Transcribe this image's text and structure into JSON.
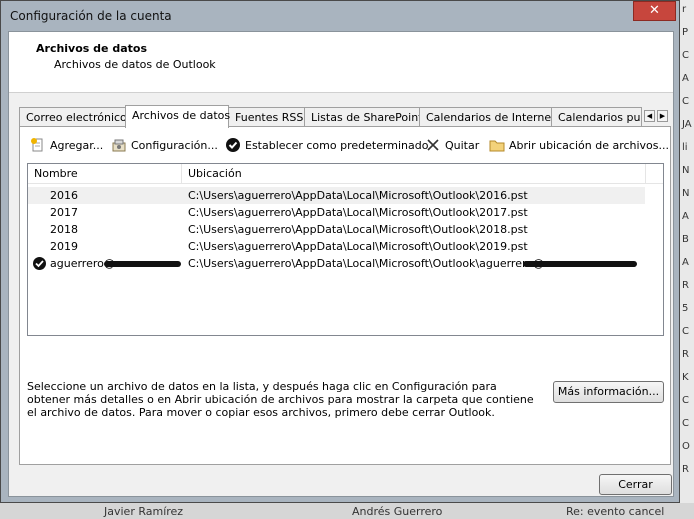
{
  "window": {
    "title": "Configuración de la cuenta",
    "close_glyph": "✕"
  },
  "header": {
    "title": "Archivos de datos",
    "subtitle": "Archivos de datos de Outlook"
  },
  "tabs": [
    {
      "label": "Correo electrónico",
      "active": false
    },
    {
      "label": "Archivos de datos",
      "active": true
    },
    {
      "label": "Fuentes RSS",
      "active": false
    },
    {
      "label": "Listas de SharePoint",
      "active": false
    },
    {
      "label": "Calendarios de Internet",
      "active": false
    },
    {
      "label": "Calendarios pul",
      "active": false
    }
  ],
  "tab_scroll": {
    "left": "◀",
    "right": "▶"
  },
  "toolbar": {
    "add": "Agregar...",
    "settings": "Configuración...",
    "set_default": "Establecer como predeterminado",
    "remove": "Quitar",
    "open_location": "Abrir ubicación de archivos..."
  },
  "list": {
    "columns": [
      "Nombre",
      "Ubicación"
    ],
    "rows": [
      {
        "name": "2016",
        "location": "C:\\Users\\aguerrero\\AppData\\Local\\Microsoft\\Outlook\\2016.pst",
        "default": false
      },
      {
        "name": "2017",
        "location": "C:\\Users\\aguerrero\\AppData\\Local\\Microsoft\\Outlook\\2017.pst",
        "default": false
      },
      {
        "name": "2018",
        "location": "C:\\Users\\aguerrero\\AppData\\Local\\Microsoft\\Outlook\\2018.pst",
        "default": false
      },
      {
        "name": "2019",
        "location": "C:\\Users\\aguerrero\\AppData\\Local\\Microsoft\\Outlook\\2019.pst",
        "default": false
      },
      {
        "name": "aguerrero@",
        "location": "C:\\Users\\aguerrero\\AppData\\Local\\Microsoft\\Outlook\\aguerrero@",
        "default": true
      }
    ]
  },
  "info": {
    "text": "Seleccione un archivo de datos en la lista, y después haga clic en Configuración para obtener más detalles o en Abrir ubicación de archivos para mostrar la carpeta que contiene el archivo de datos. Para mover o copiar esos archivos, primero debe cerrar Outlook.",
    "more_button": "Más información..."
  },
  "footer": {
    "close_button": "Cerrar"
  },
  "background": {
    "bottom_items": [
      "Javier Ramírez",
      "Andrés Guerrero",
      "Re: evento cancel"
    ],
    "right_letters": [
      "r",
      "P",
      "C",
      "A",
      "C",
      "JA",
      "li",
      "N",
      "N",
      "A",
      "B",
      "A",
      "R",
      "5",
      "C",
      "R",
      "K",
      "C",
      "C",
      "O",
      "R"
    ]
  }
}
